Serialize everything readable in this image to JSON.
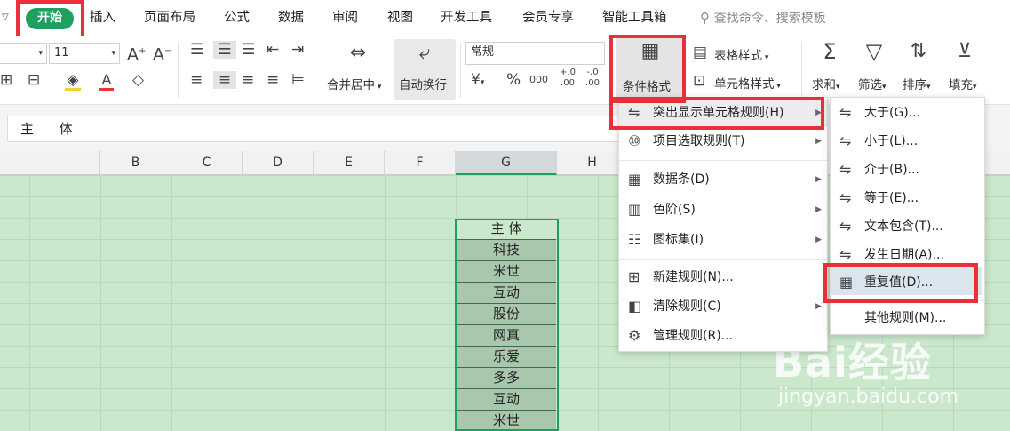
{
  "menu_tabs": {
    "start": "开始",
    "insert": "插入",
    "layout": "页面布局",
    "formula": "公式",
    "data": "数据",
    "review": "审阅",
    "view": "视图",
    "dev": "开发工具",
    "member": "会员专享",
    "smart": "智能工具箱",
    "search": "查找命令、搜索模板"
  },
  "ribbon": {
    "font_size": "11",
    "merge_center": "合并居中",
    "wrap_text": "自动换行",
    "number_format": "常规",
    "conditional_format": "条件格式",
    "table_style": "表格样式",
    "cell_style": "单元格样式",
    "sum": "求和",
    "filter": "筛选",
    "sort": "排序",
    "fill": "填充",
    "currency": "¥",
    "percent": "%",
    "thousands": "000",
    "inc_dec": "+.0 .00",
    "dec_dec": "-.0 .00",
    "font_grow": "A",
    "font_shrink": "A",
    "font_color": "A"
  },
  "formula_bar": {
    "content": "主 体"
  },
  "columns": [
    "B",
    "C",
    "D",
    "E",
    "F",
    "G",
    "H"
  ],
  "cells": {
    "header": "主 体",
    "values": [
      "科技",
      "米世",
      "互动",
      "股份",
      "网真",
      "乐爱",
      "多多",
      "互动",
      "米世"
    ]
  },
  "menu1": {
    "highlight_cells": "突出显示单元格规则(H)",
    "top_bottom": "项目选取规则(T)",
    "data_bars": "数据条(D)",
    "color_scale": "色阶(S)",
    "icon_sets": "图标集(I)",
    "new_rule": "新建规则(N)...",
    "clear_rules": "清除规则(C)",
    "manage_rules": "管理规则(R)..."
  },
  "menu2": {
    "greater": "大于(G)...",
    "less": "小于(L)...",
    "between": "介于(B)...",
    "equal": "等于(E)...",
    "text_contains": "文本包含(T)...",
    "date": "发生日期(A)...",
    "duplicate": "重复值(D)...",
    "other": "其他规则(M)..."
  },
  "watermark": {
    "logo": "Bai经验",
    "url": "jingyan.baidu.com"
  },
  "colors": {
    "accent": "#1ea05f",
    "highlight_red": "#ea2f3a",
    "sheet_green": "#cbe8cc"
  }
}
